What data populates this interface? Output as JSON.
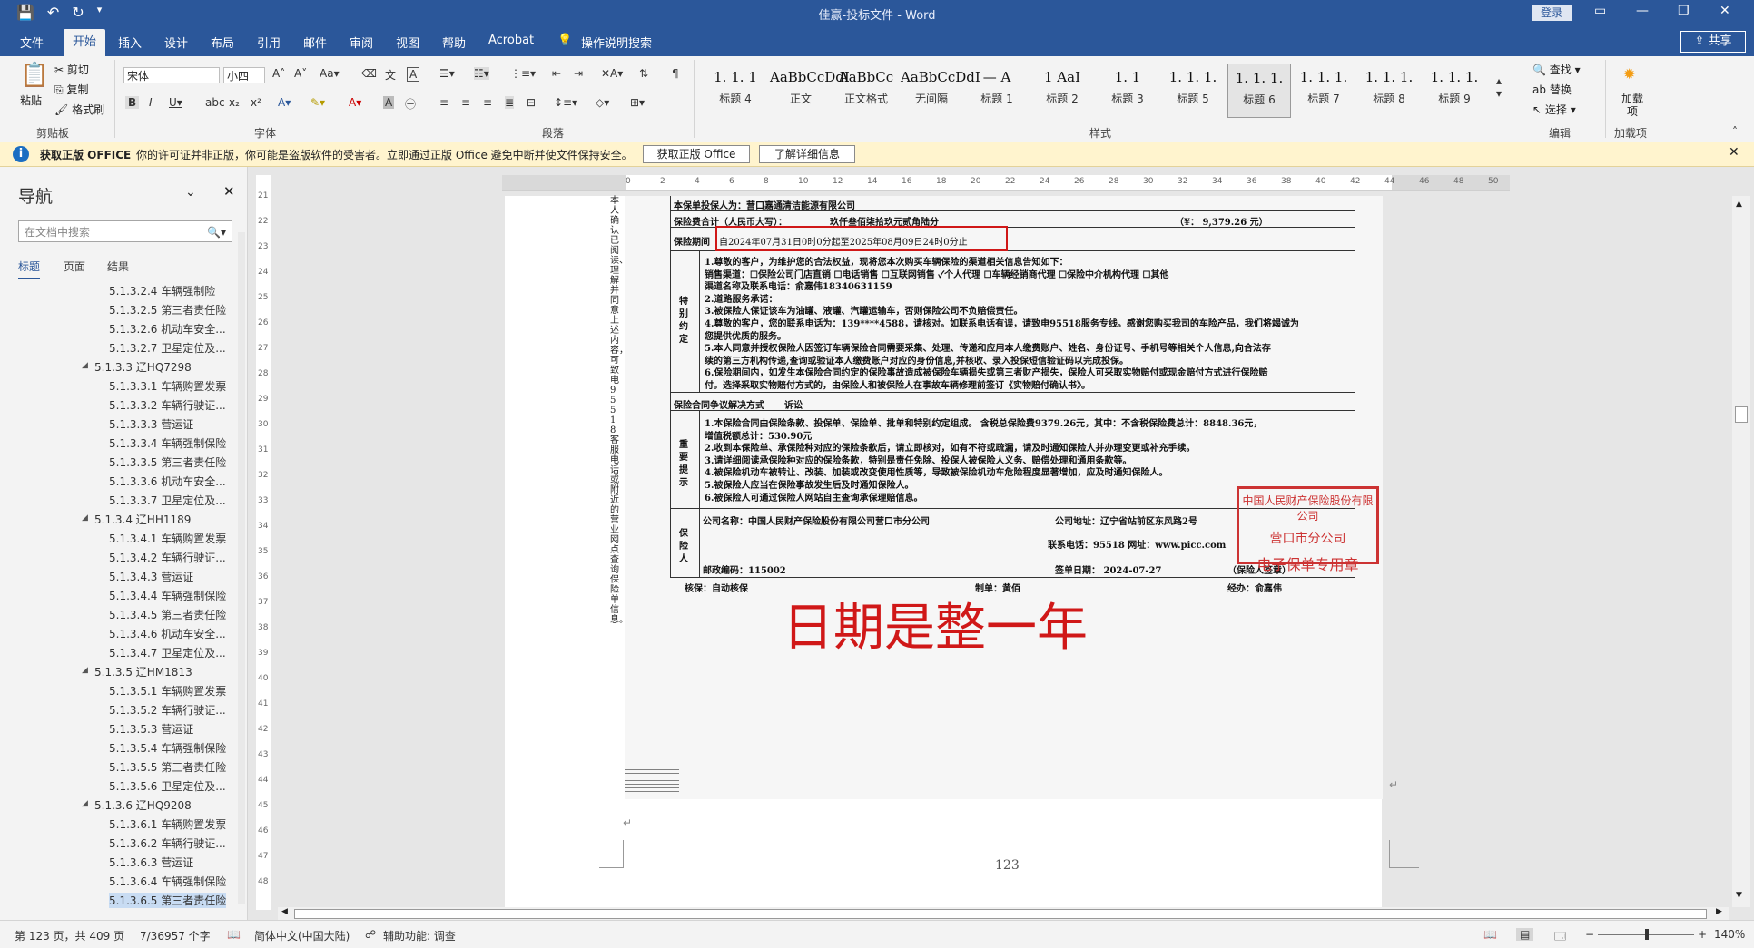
{
  "titlebar": {
    "title": "佳赢-投标文件 - Word",
    "login": "登录",
    "qat_icons": [
      "save-icon",
      "undo-icon",
      "redo-icon",
      "customize-icon"
    ]
  },
  "tabs": [
    "文件",
    "开始",
    "插入",
    "设计",
    "布局",
    "引用",
    "邮件",
    "审阅",
    "视图",
    "帮助",
    "Acrobat",
    "操作说明搜索"
  ],
  "active_tab": "开始",
  "share": "共享",
  "ribbon": {
    "clipboard": {
      "paste": "粘贴",
      "cut": "剪切",
      "copy": "复制",
      "format_painter": "格式刷",
      "label": "剪贴板"
    },
    "font": {
      "name": "宋体",
      "size": "小四",
      "label": "字体"
    },
    "paragraph_label": "段落",
    "styles": [
      {
        "preview": "1. 1. 1",
        "name": "标题 4"
      },
      {
        "preview": "AaBbCcDdI",
        "name": "正文"
      },
      {
        "preview": "AaBbCc",
        "name": "正文格式"
      },
      {
        "preview": "AaBbCcDdI",
        "name": "无间隔"
      },
      {
        "preview": "—  A",
        "name": "标题 1"
      },
      {
        "preview": "1  AaI",
        "name": "标题 2"
      },
      {
        "preview": "1. 1",
        "name": "标题 3"
      },
      {
        "preview": "1. 1. 1.",
        "name": "标题 5"
      },
      {
        "preview": "1. 1. 1.",
        "name": "标题 6"
      },
      {
        "preview": "1. 1. 1.",
        "name": "标题 7"
      },
      {
        "preview": "1. 1. 1.",
        "name": "标题 8"
      },
      {
        "preview": "1. 1. 1.",
        "name": "标题 9"
      }
    ],
    "styles_label": "样式",
    "editing": {
      "find": "查找",
      "replace": "替换",
      "select": "选择",
      "label": "编辑"
    },
    "addins": {
      "button": "加载项",
      "label": "加载项"
    }
  },
  "license_bar": {
    "title": "获取正版 OFFICE",
    "message": "你的许可证并非正版，你可能是盗版软件的受害者。立即通过正版 Office 避免中断并使文件保持安全。",
    "btn_genuine": "获取正版 Office",
    "btn_more": "了解详细信息"
  },
  "nav": {
    "title": "导航",
    "search_placeholder": "在文档中搜索",
    "tabs": [
      "标题",
      "页面",
      "结果"
    ],
    "items": [
      {
        "text": "5.1.3.2.4 车辆强制险",
        "level": 2
      },
      {
        "text": "5.1.3.2.5 第三者责任险",
        "level": 2
      },
      {
        "text": "5.1.3.2.6 机动车安全...",
        "level": 2
      },
      {
        "text": "5.1.3.2.7 卫星定位及...",
        "level": 2
      },
      {
        "text": "5.1.3.3 辽HQ7298",
        "level": 1
      },
      {
        "text": "5.1.3.3.1 车辆购置发票",
        "level": 2
      },
      {
        "text": "5.1.3.3.2 车辆行驶证...",
        "level": 2
      },
      {
        "text": "5.1.3.3.3 营运证",
        "level": 2
      },
      {
        "text": "5.1.3.3.4 车辆强制保险",
        "level": 2
      },
      {
        "text": "5.1.3.3.5 第三者责任险",
        "level": 2
      },
      {
        "text": "5.1.3.3.6 机动车安全...",
        "level": 2
      },
      {
        "text": "5.1.3.3.7 卫星定位及...",
        "level": 2
      },
      {
        "text": "5.1.3.4 辽HH1189",
        "level": 1
      },
      {
        "text": "5.1.3.4.1 车辆购置发票",
        "level": 2
      },
      {
        "text": "5.1.3.4.2 车辆行驶证...",
        "level": 2
      },
      {
        "text": "5.1.3.4.3 营运证",
        "level": 2
      },
      {
        "text": "5.1.3.4.4 车辆强制保险",
        "level": 2
      },
      {
        "text": "5.1.3.4.5 第三者责任险",
        "level": 2
      },
      {
        "text": "5.1.3.4.6 机动车安全...",
        "level": 2
      },
      {
        "text": "5.1.3.4.7 卫星定位及...",
        "level": 2
      },
      {
        "text": "5.1.3.5 辽HM1813",
        "level": 1
      },
      {
        "text": "5.1.3.5.1 车辆购置发票",
        "level": 2
      },
      {
        "text": "5.1.3.5.2 车辆行驶证...",
        "level": 2
      },
      {
        "text": "5.1.3.5.3 营运证",
        "level": 2
      },
      {
        "text": "5.1.3.5.4 车辆强制保险",
        "level": 2
      },
      {
        "text": "5.1.3.5.5 第三者责任险",
        "level": 2
      },
      {
        "text": "5.1.3.5.6 卫星定位及...",
        "level": 2
      },
      {
        "text": "5.1.3.6 辽HQ9208",
        "level": 1
      },
      {
        "text": "5.1.3.6.1 车辆购置发票",
        "level": 2
      },
      {
        "text": "5.1.3.6.2 车辆行驶证...",
        "level": 2
      },
      {
        "text": "5.1.3.6.3 营运证",
        "level": 2
      },
      {
        "text": "5.1.3.6.4 车辆强制保险",
        "level": 2
      },
      {
        "text": "5.1.3.6.5 第三者责任险",
        "level": 2,
        "selected": true
      }
    ]
  },
  "document": {
    "insured": "本保单投保人为：营口嘉通清洁能源有限公司",
    "premium_label": "保险费合计（人民币大写）：",
    "premium_words": "玖仟叁佰柒拾玖元贰角陆分",
    "premium_amount": "（¥：  9,379.26        元）",
    "period_label": "保险期间",
    "period_value": "自2024年07月31日0时0分起至2025年08月09日24时0分止",
    "special_label": "特别约定",
    "special_lines": [
      "1.尊敬的客户，为维护您的合法权益，现将您本次购买车辆保险的渠道相关信息告知如下：",
      "销售渠道：☐保险公司门店直销 ☐电话销售 ☐互联网销售 ✓个人代理 ☐车辆经销商代理 ☐保险中介机构代理 ☐其他",
      "渠道名称及联系电话：俞嘉伟18340631159",
      "2.道路服务承诺：",
      "3.被保险人保证该车为油罐、液罐、汽罐运输车，否则保险公司不负赔偿责任。",
      "4.尊敬的客户，您的联系电话为：139****4588，请核对。如联系电话有误，请致电95518服务专线。感谢您购买我司的车险产品，我们将竭诚为",
      "您提供优质的服务。",
      "5.本人同意并授权保险人因签订车辆保险合同需要采集、处理、传递和应用本人缴费账户、姓名、身份证号、手机号等相关个人信息,向合法存",
      "续的第三方机构传递,查询或验证本人缴费账户对应的身份信息,并核收、录入投保短信验证码以完成投保。",
      "6.保险期间内，如发生本保险合同约定的保险事故造成被保险车辆损失或第三者财产损失，保险人可采取实物赔付或现金赔付方式进行保险赔",
      "付。选择采取实物赔付方式的，由保险人和被保险人在事故车辆修理前签订《实物赔付确认书》。"
    ],
    "dispute_label": "保险合同争议解决方式",
    "dispute_value": "诉讼",
    "notice_label": "重要提示",
    "notice_lines": [
      "1.本保险合同由保险条款、投保单、保险单、批单和特别约定组成。       含税总保险费9379.26元，其中：不含税保险费总计：8848.36元，",
      "增值税额总计：530.90元",
      "2.收到本保险单、承保险种对应的保险条款后，请立即核对，如有不符或疏漏，请及时通知保险人并办理变更或补充手续。",
      "3.请详细阅读承保险种对应的保险条款，特别是责任免除、投保人被保险人义务、赔偿处理和通用条款等。",
      "4.被保险机动车被转让、改装、加装或改变使用性质等，导致被保险机动车危险程度显著增加，应及时通知保险人。",
      "5.被保险人应当在保险事故发生后及时通知保险人。",
      "6.被保险人可通过保险人网站自主查询承保理赔信息。"
    ],
    "insurer_label": "保险人",
    "company_name": "公司名称：中国人民财产保险股份有限公司营口市分公司",
    "company_address": "公司地址：辽宁省站前区东风路2号",
    "phone": "联系电话：95518  网址：www.picc.com",
    "postcode": "邮政编码：115002",
    "sign_date": "签单日期：  2024-07-27",
    "signature_note": "（保险人签章）",
    "review": "核保：自动核保",
    "maker": "制单：黄佰",
    "handler": "经办：俞嘉伟",
    "side_note": "本人确认已阅读、理解并同意上述内容，可致电95518客服电话或附近的营业网点查询保险单信息。",
    "stamp_lines": [
      "中国人民财产保险股份有限公司",
      "营口市分公司",
      "电子保单专用章"
    ],
    "annotation": "日期是整一年",
    "page_number": "123"
  },
  "statusbar": {
    "page": "第 123 页，共 409 页",
    "words": "7/36957 个字",
    "language": "简体中文(中国大陆)",
    "accessibility": "辅助功能: 调查",
    "zoom": "140%"
  },
  "colors": {
    "accent": "#2b579a",
    "highlight_red": "#d01818",
    "license_bar": "#fff4ce",
    "stamp": "#cc3333"
  }
}
